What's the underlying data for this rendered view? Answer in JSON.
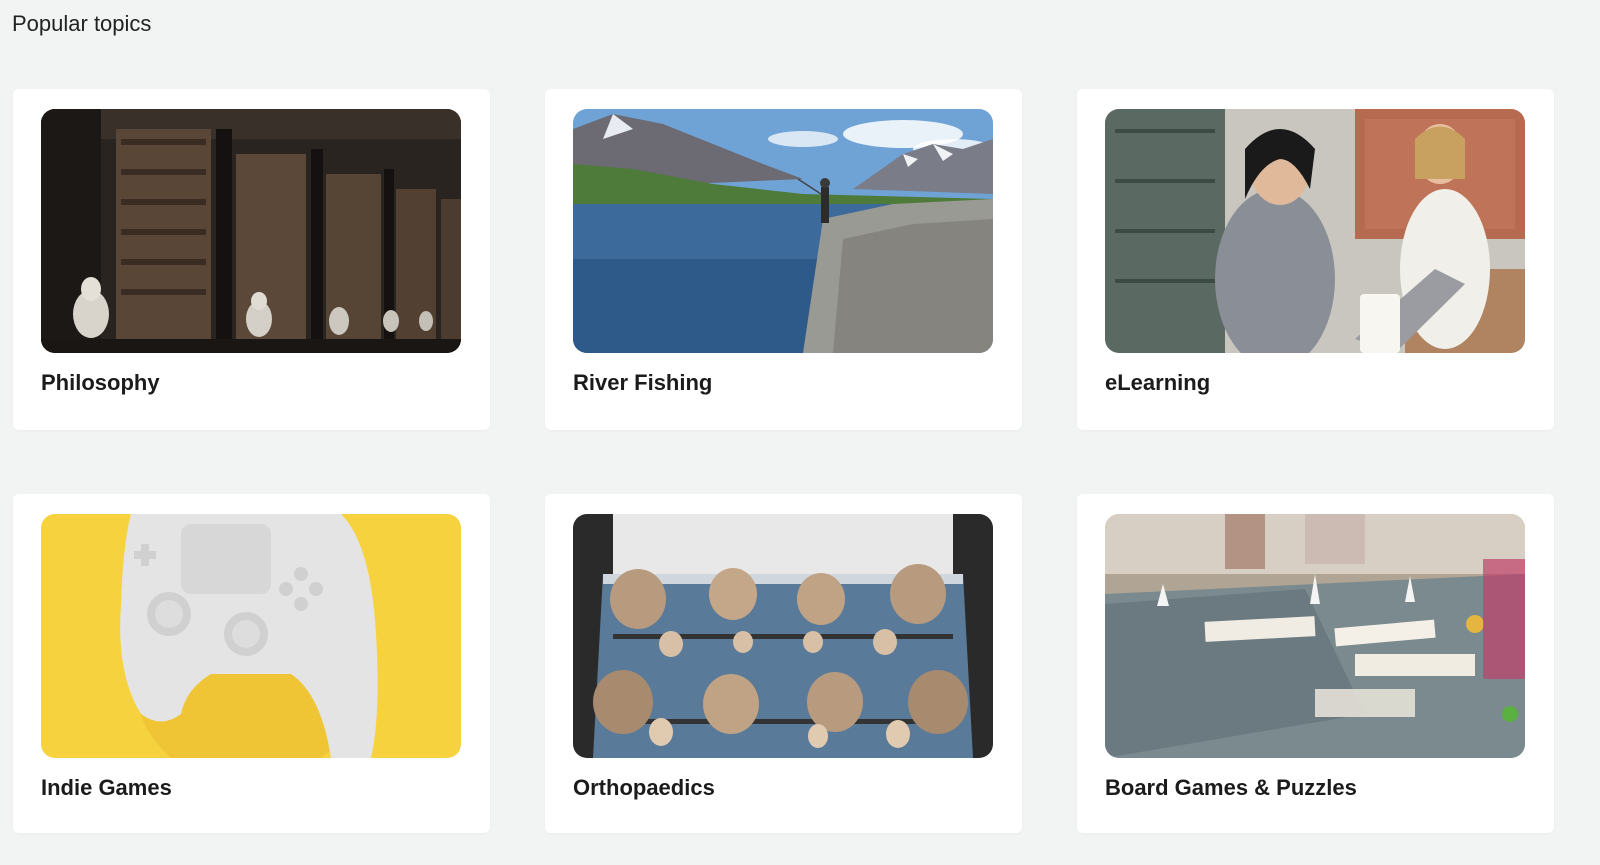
{
  "section": {
    "title": "Popular topics"
  },
  "topics": [
    {
      "label": "Philosophy",
      "image": "library-with-busts-image"
    },
    {
      "label": "River Fishing",
      "image": "river-fishing-mountains-image"
    },
    {
      "label": "eLearning",
      "image": "people-with-laptop-image"
    },
    {
      "label": "Indie Games",
      "image": "game-controller-image"
    },
    {
      "label": "Orthopaedics",
      "image": "skull-display-image"
    },
    {
      "label": "Board Games & Puzzles",
      "image": "board-game-table-image"
    }
  ]
}
